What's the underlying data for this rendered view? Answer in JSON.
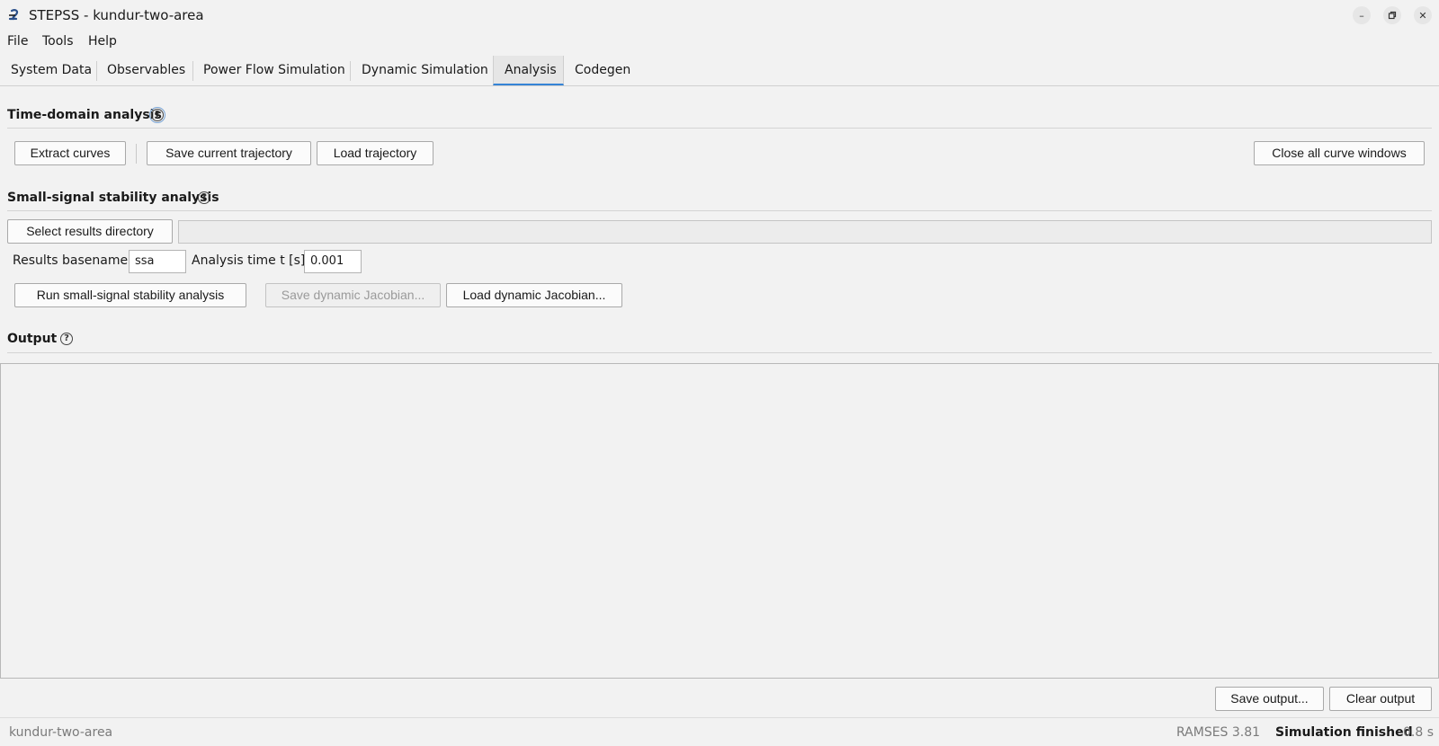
{
  "window": {
    "title": "STEPSS - kundur-two-area",
    "logo_glyph": "S"
  },
  "menu": [
    "File",
    "Tools",
    "Help"
  ],
  "tabs": [
    {
      "label": "System Data",
      "active": false
    },
    {
      "label": "Observables",
      "active": false
    },
    {
      "label": "Power Flow Simulation",
      "active": false
    },
    {
      "label": "Dynamic Simulation",
      "active": false
    },
    {
      "label": "Analysis",
      "active": true
    },
    {
      "label": "Codegen",
      "active": false
    }
  ],
  "time_domain": {
    "title": "Time-domain analysis",
    "extract_curves": "Extract curves",
    "save_trajectory": "Save current trajectory",
    "load_trajectory": "Load trajectory",
    "close_all": "Close all curve windows"
  },
  "ssa": {
    "title": "Small-signal stability analysis",
    "select_dir": "Select results directory",
    "dir_value": "",
    "basename_label": "Results basename",
    "basename_value": "ssa",
    "time_label": "Analysis time t [s]",
    "time_value": "0.001",
    "run": "Run small-signal stability analysis",
    "save_jacobian": "Save dynamic Jacobian...",
    "load_jacobian": "Load dynamic Jacobian..."
  },
  "output": {
    "title": "Output",
    "text": "",
    "save": "Save output...",
    "clear": "Clear output"
  },
  "status": {
    "project": "kundur-two-area",
    "version": "RAMSES 3.81",
    "state": "Simulation finished",
    "elapsed": "0.8 s"
  },
  "icons": {
    "help": "help-circle-icon",
    "minimize": "minimize-icon",
    "restore": "restore-icon",
    "close": "close-icon"
  },
  "colors": {
    "accent": "#3584d6",
    "logo": "#2a4f8a"
  }
}
